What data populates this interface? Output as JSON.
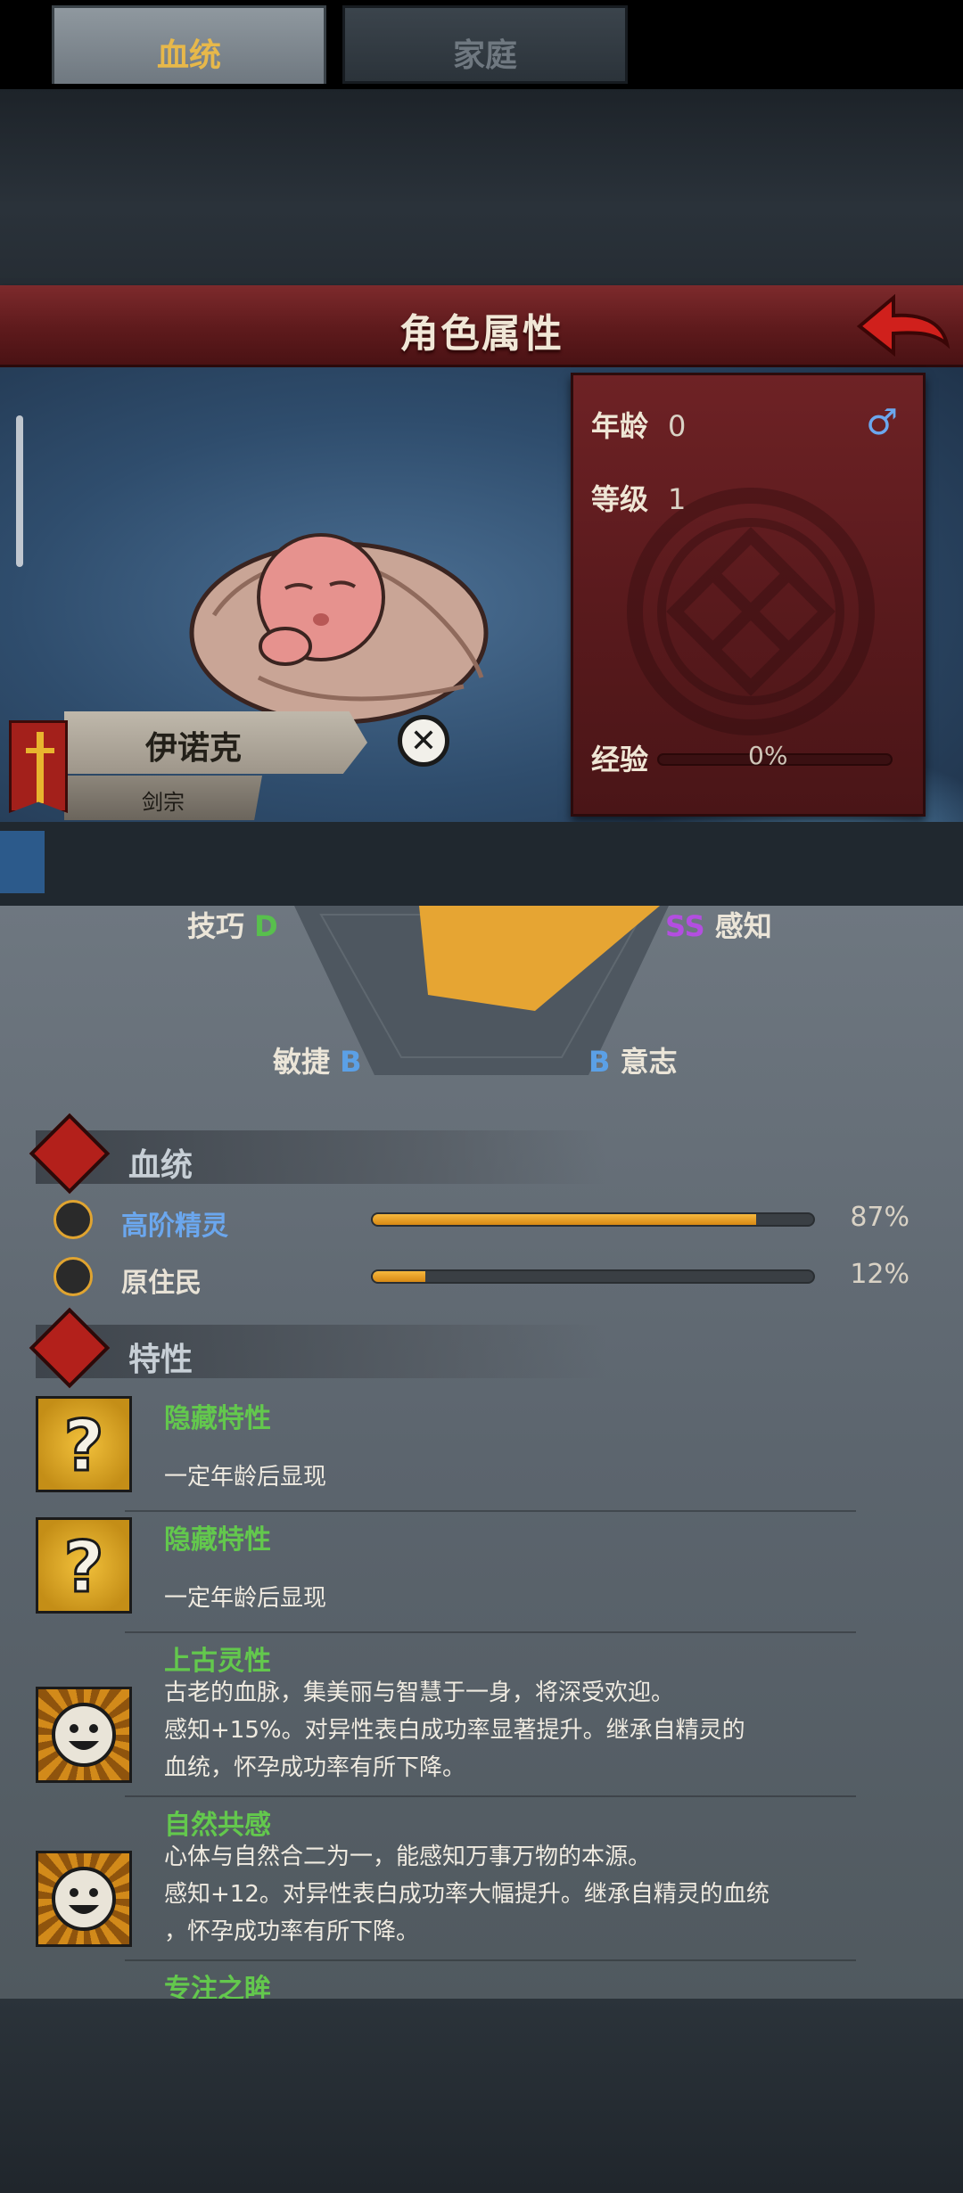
{
  "header": {
    "title": "角色属性"
  },
  "character": {
    "name": "伊诺克",
    "class_name": "剑宗",
    "stats": [
      {
        "label": "年龄",
        "value": "0"
      },
      {
        "label": "等级",
        "value": "1"
      }
    ],
    "experience": {
      "label": "经验",
      "percent_text": "0%",
      "fraction": 0.0
    },
    "gender_icon": "male-icon"
  },
  "tabs": [
    {
      "label": "血统",
      "active": true
    },
    {
      "label": "家庭",
      "active": false
    }
  ],
  "attributes": {
    "top_left": {
      "label": "技巧",
      "grade": "D"
    },
    "top_right": {
      "label": "感知",
      "grade": "SS"
    },
    "bottom_left": {
      "label": "敏捷",
      "grade": "B"
    },
    "bottom_right": {
      "label": "意志",
      "grade": "B"
    }
  },
  "lineage_section": {
    "title": "血统",
    "items": [
      {
        "name": "高阶精灵",
        "percent_text": "87%",
        "fraction": 0.87,
        "color": "#6ba7ee",
        "icon": "elf-swirl-icon"
      },
      {
        "name": "原住民",
        "percent_text": "12%",
        "fraction": 0.12,
        "color": "#e8e2d6",
        "icon": "leaf-icon"
      }
    ]
  },
  "traits_section": {
    "title": "特性",
    "items": [
      {
        "name": "隐藏特性",
        "desc": "一定年龄后显现",
        "icon": "question-mark-icon"
      },
      {
        "name": "隐藏特性",
        "desc": "一定年龄后显现",
        "icon": "question-mark-icon"
      },
      {
        "name": "上古灵性",
        "desc": "古老的血脉，集美丽与智慧于一身，将深受欢迎。\n感知+15%。对异性表白成功率显著提升。继承自精灵的\n血统，怀孕成功率有所下降。",
        "icon": "smiling-face-icon"
      },
      {
        "name": "自然共感",
        "desc": "心体与自然合二为一，能感知万事万物的本源。\n感知+12。对异性表白成功率大幅提升。继承自精灵的血统\n，怀孕成功率有所下降。",
        "icon": "smiling-face-icon"
      },
      {
        "name": "专注之眸",
        "desc": "",
        "icon": "trait-icon"
      }
    ]
  },
  "colors": {
    "accent_gold": "#e7b84a",
    "trait_green": "#63c84d",
    "grade_blue": "#5ba0e6",
    "grade_green": "#58c04d",
    "grade_purple": "#b34ee0"
  }
}
